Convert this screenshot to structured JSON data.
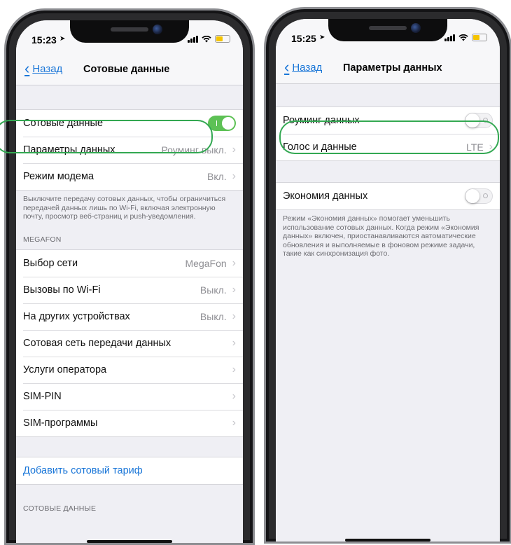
{
  "left": {
    "status": {
      "time": "15:23"
    },
    "nav": {
      "back": "Назад",
      "title": "Сотовые данные"
    },
    "group1": [
      {
        "label": "Сотовые данные",
        "control": "toggle-on"
      },
      {
        "label": "Параметры данных",
        "value": "Роуминг выкл."
      },
      {
        "label": "Режим модема",
        "value": "Вкл."
      }
    ],
    "footnote": "Выключите передачу сотовых данных, чтобы ограничиться передачей данных лишь по Wi‑Fi, включая электронную почту, просмотр веб‑страниц и push‑уведомления.",
    "section_header": "MEGAFON",
    "group2": [
      {
        "label": "Выбор сети",
        "value": "MegaFon"
      },
      {
        "label": "Вызовы по Wi‑Fi",
        "value": "Выкл."
      },
      {
        "label": "На других устройствах",
        "value": "Выкл."
      },
      {
        "label": "Сотовая сеть передачи данных",
        "value": ""
      },
      {
        "label": "Услуги оператора",
        "value": ""
      },
      {
        "label": "SIM‑PIN",
        "value": ""
      },
      {
        "label": "SIM‑программы",
        "value": ""
      }
    ],
    "add_plan": "Добавить сотовый тариф",
    "bottom_header": "СОТОВЫЕ ДАННЫЕ"
  },
  "right": {
    "status": {
      "time": "15:25"
    },
    "nav": {
      "back": "Назад",
      "title": "Параметры данных"
    },
    "group1": [
      {
        "label": "Роуминг данных",
        "control": "toggle-off"
      },
      {
        "label": "Голос и данные",
        "value": "LTE"
      }
    ],
    "group2": [
      {
        "label": "Экономия данных",
        "control": "toggle-off"
      }
    ],
    "footnote": "Режим «Экономия данных» помогает уменьшить использование сотовых данных. Когда режим «Экономия данных» включен, приостанавливаются автоматические обновления и выполняемые в фоновом режиме задачи, такие как синхронизация фото."
  },
  "colors": {
    "accent_link": "#1a76d8",
    "toggle_on": "#5dc155",
    "highlight": "#33a852",
    "battery": "#f5c400"
  }
}
